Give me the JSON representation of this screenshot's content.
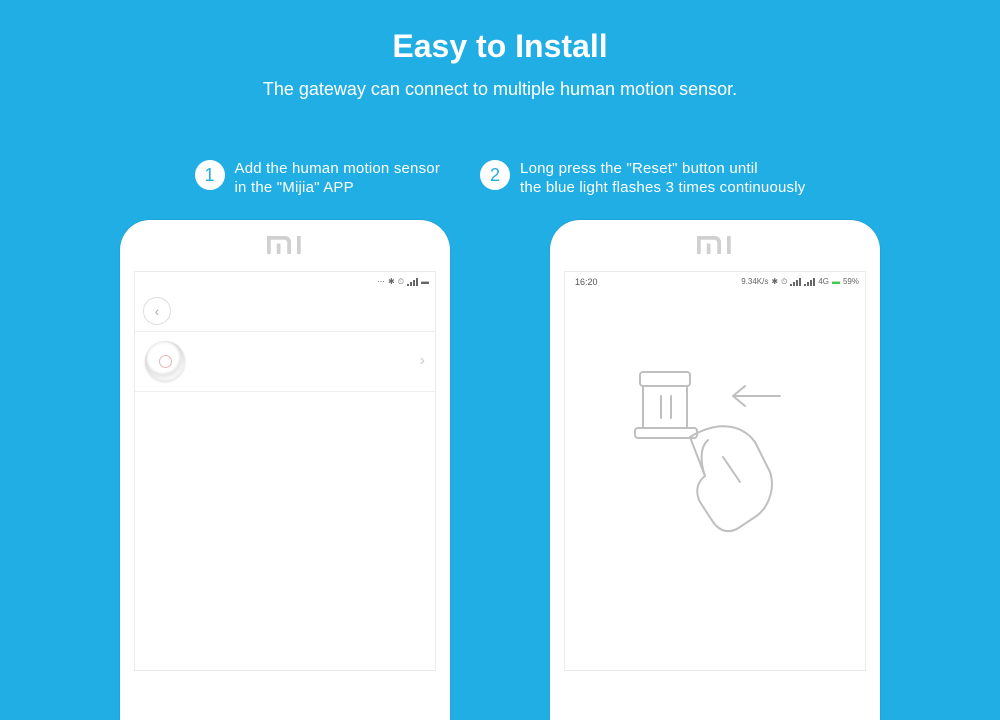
{
  "header": {
    "title": "Easy to Install",
    "subtitle": "The gateway can connect to multiple human motion sensor."
  },
  "steps": [
    {
      "num": "1",
      "text_line1": "Add the human motion sensor",
      "text_line2": " in the \"Mijia\" APP"
    },
    {
      "num": "2",
      "text_line1": "Long press the \"Reset\" button until",
      "text_line2": "the blue light flashes 3 times continuously"
    }
  ],
  "phone1": {
    "statusbar": {
      "bt": "✱",
      "alarm": "⏰",
      "wifi": "📶",
      "battery": "▮"
    }
  },
  "phone2": {
    "statusbar": {
      "time": "16:20",
      "speed": "9.34K/s",
      "bt": "✱",
      "alarm": "⏰",
      "net": "4G",
      "battery_pct": "59%"
    }
  }
}
